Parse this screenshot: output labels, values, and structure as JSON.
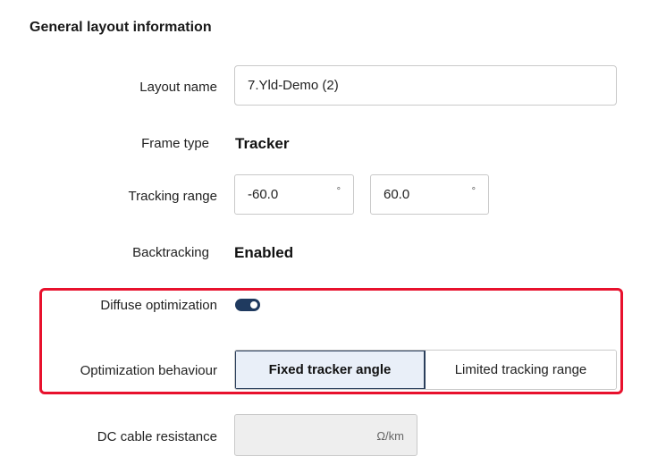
{
  "section": {
    "title": "General layout information"
  },
  "layout_name": {
    "label": "Layout name",
    "value": "7.Yld-Demo (2)"
  },
  "frame_type": {
    "label": "Frame type",
    "value": "Tracker"
  },
  "tracking_range": {
    "label": "Tracking range",
    "min": "-60.0",
    "max": "60.0",
    "unit": "°"
  },
  "backtracking": {
    "label": "Backtracking",
    "value": "Enabled"
  },
  "diffuse_optimization": {
    "label": "Diffuse optimization",
    "enabled": true
  },
  "optimization_behaviour": {
    "label": "Optimization behaviour",
    "options": [
      "Fixed tracker angle",
      "Limited tracking range"
    ],
    "selected": "Fixed tracker angle"
  },
  "dc_cable_resistance": {
    "label": "DC cable resistance",
    "value": "",
    "unit": "Ω/km"
  },
  "colors": {
    "highlight_border": "#e8112d",
    "toggle_on": "#1f3a5f",
    "selected_segment_bg": "#e9eff8"
  }
}
